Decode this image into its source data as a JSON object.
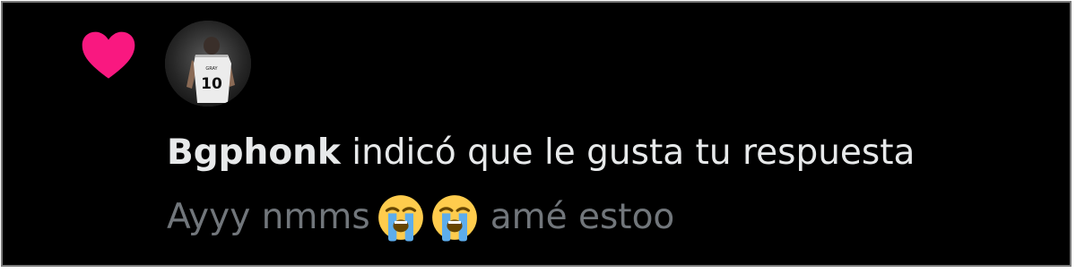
{
  "notification": {
    "type_icon": "heart-icon",
    "accent_color": "#f91880",
    "avatar_jersey_number": "10",
    "username": "Bgphonk",
    "action_text": "indicó que le gusta tu respuesta",
    "reply_text_before": "Ayyy nmms",
    "reply_emojis": [
      "loudly-crying-face-emoji",
      "loudly-crying-face-emoji"
    ],
    "reply_text_after": "amé estoo"
  }
}
